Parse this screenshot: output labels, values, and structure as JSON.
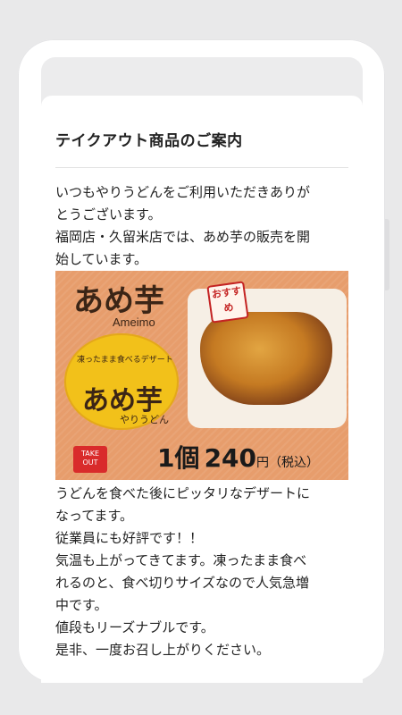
{
  "card": {
    "title": "テイクアウト商品のご案内",
    "intro_lines": [
      "いつもやりうどんをご利用いただきありが",
      "とうございます。",
      "福岡店・久留米店では、あめ芋の販売を開",
      "始しています。"
    ],
    "body_lines": [
      "うどんを食べた後にピッタリなデザートに",
      "なってます。",
      "従業員にも好評です！！",
      "気温も上がってきてます。凍ったまま食べ",
      "れるのと、食べ切りサイズなので人気急増",
      "中です。",
      "値段もリーズナブルです。",
      "是非、一度お召し上がりください。"
    ]
  },
  "promo": {
    "title": "あめ芋",
    "romaji": "Ameimo",
    "badge_text": "凍ったまま食べるデザート",
    "badge_title": "あめ芋",
    "badge_brand": "やりうどん",
    "recommend": "おすすめ",
    "takeout": "TAKE OUT",
    "price_count": "1個",
    "price_value": "240",
    "price_unit": "円",
    "price_tax": "（税込）"
  },
  "colors": {
    "promo_bg": "#e79d6c",
    "badge": "#f2c11a",
    "accent_red": "#d92b2b"
  }
}
